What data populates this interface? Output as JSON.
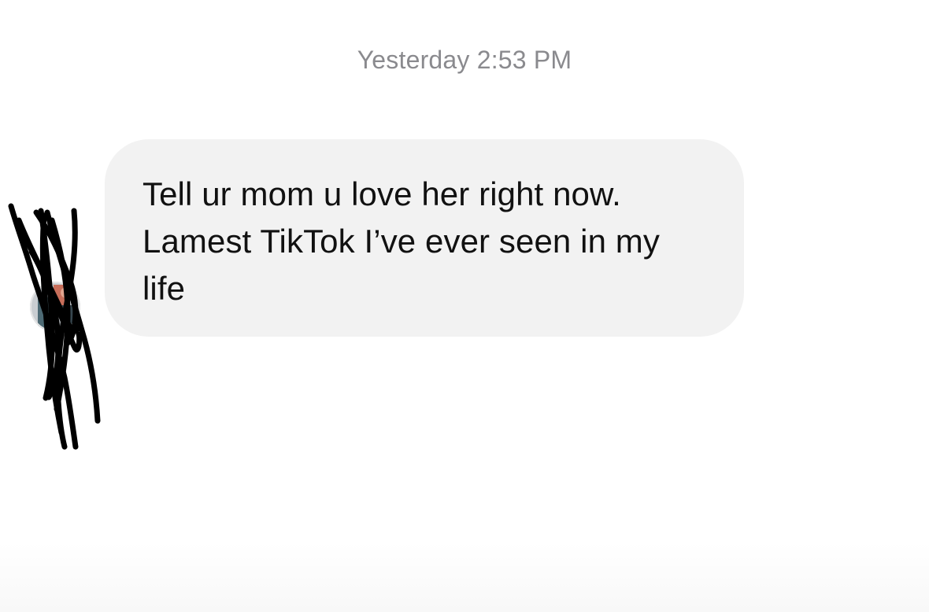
{
  "conversation": {
    "timestamp": "Yesterday 2:53 PM",
    "messages": [
      {
        "direction": "incoming",
        "text": "Tell ur mom u love her right now. Lamest TikTok I’ve ever seen in my life"
      }
    ]
  },
  "colors": {
    "bubble_background": "#f2f2f2",
    "timestamp_text": "#8a8a8e",
    "message_text": "#111111",
    "redaction_scribble": "#000000"
  },
  "icons": {
    "sender_avatar": "avatar-icon",
    "redaction": "redaction-scribble"
  }
}
